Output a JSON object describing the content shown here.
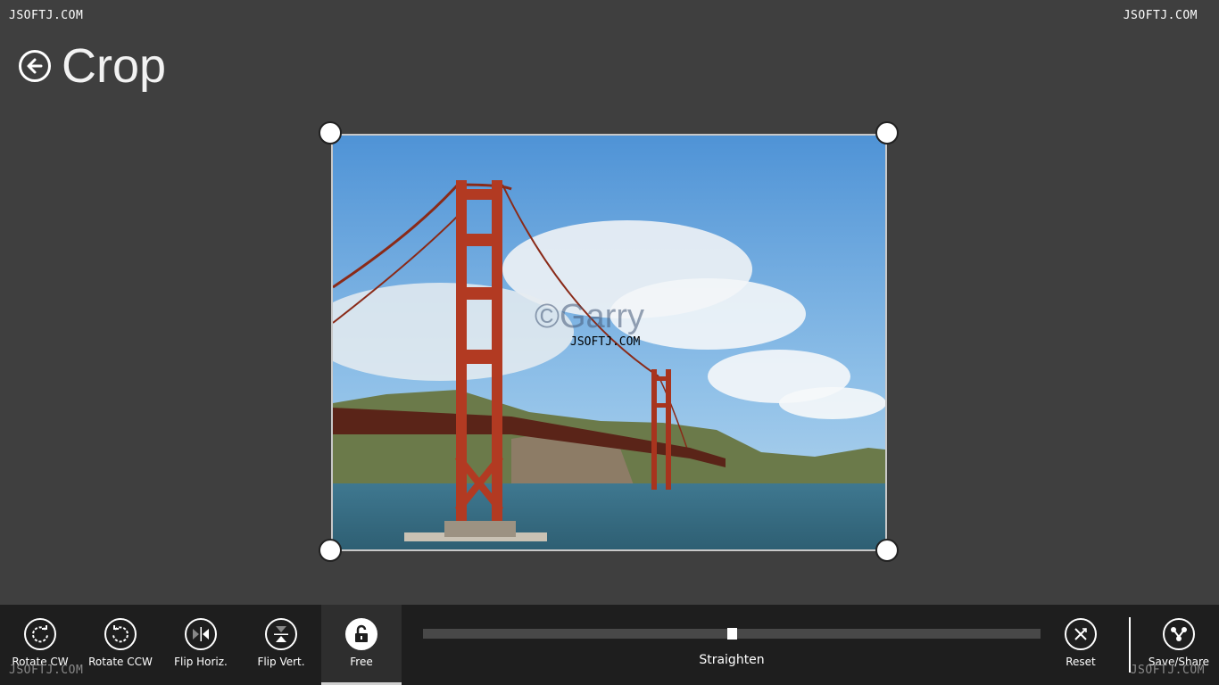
{
  "watermarks": {
    "top_left": "JSOFTJ.COM",
    "top_right": "JSOFTJ.COM",
    "bottom_left": "JSOFTJ.COM",
    "bottom_right": "JSOFTJ.COM"
  },
  "header": {
    "title": "Crop",
    "back_icon": "back-arrow-icon"
  },
  "photo": {
    "copyright": "©Garry",
    "watermark": "JSOFTJ.COM"
  },
  "toolbar": {
    "rotate_cw": "Rotate CW",
    "rotate_ccw": "Rotate CCW",
    "flip_horiz": "Flip Horiz.",
    "flip_vert": "Flip Vert.",
    "free": "Free",
    "reset": "Reset",
    "save_share": "Save/Share"
  },
  "straighten": {
    "label": "Straighten",
    "value": 0.5
  },
  "colors": {
    "background": "#3f3f3f",
    "appbar": "#1e1e1e",
    "accent": "#ffffff"
  }
}
